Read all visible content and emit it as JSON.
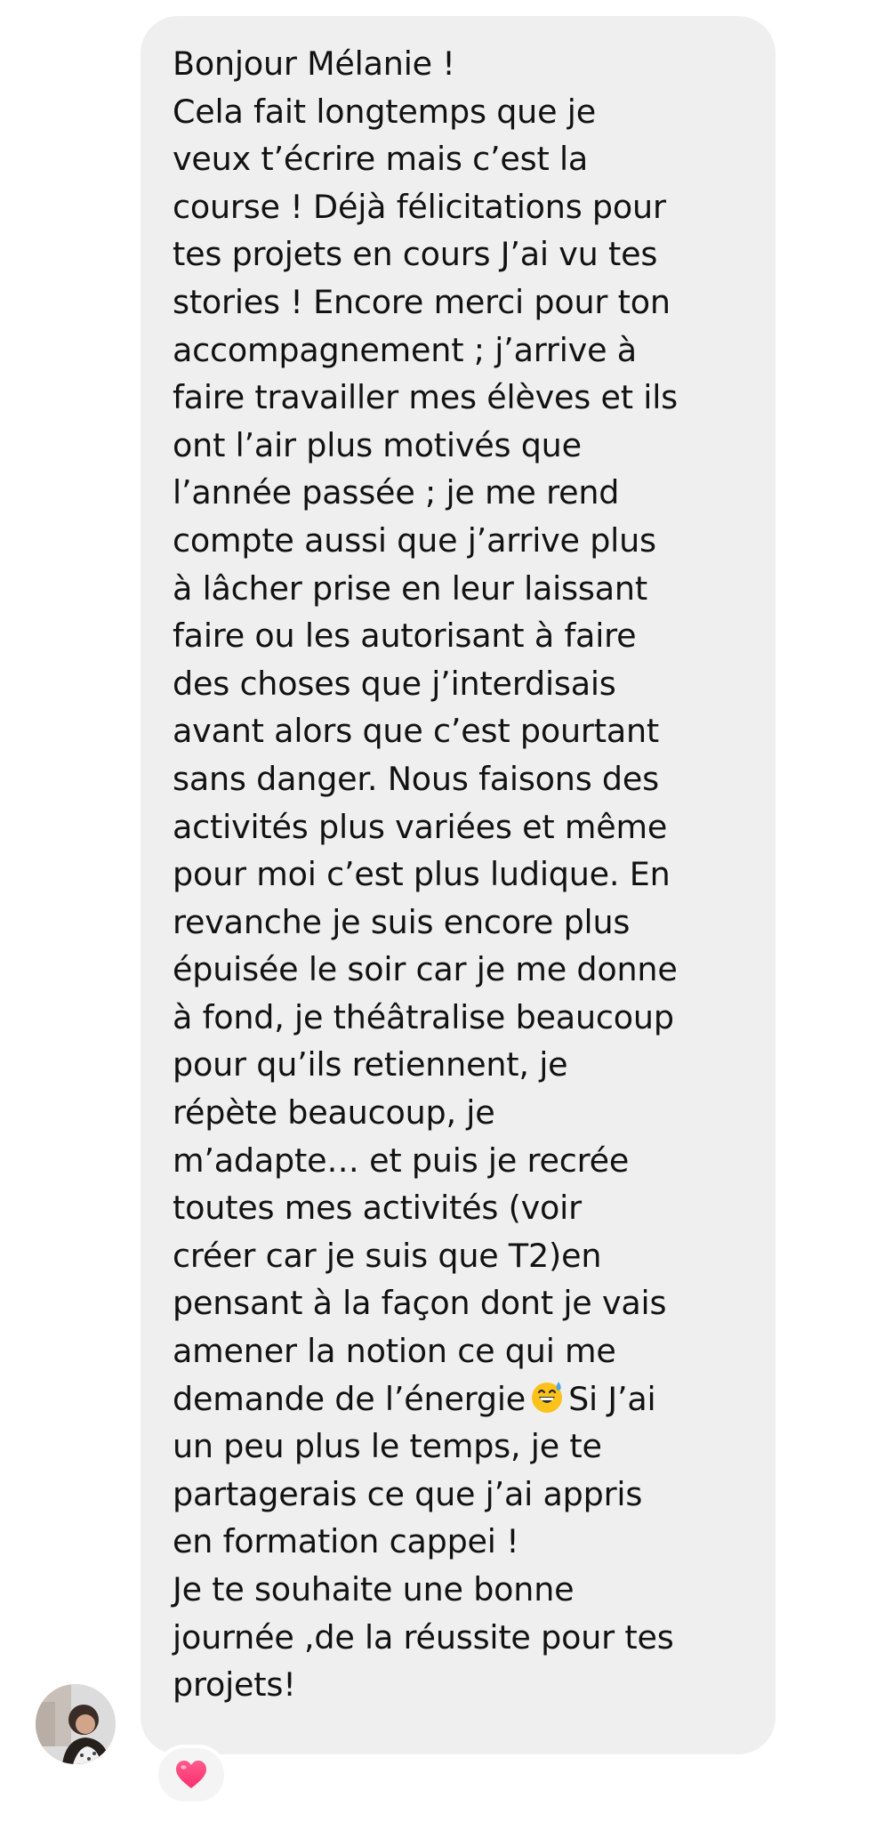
{
  "message": {
    "lines": [
      "Bonjour Mélanie !",
      "Cela fait longtemps que je",
      "veux t’écrire mais c’est la",
      "course ! Déjà félicitations pour",
      "tes projets en cours J’ai vu tes",
      "stories ! Encore merci pour ton",
      "accompagnement ; j’arrive à",
      "faire travailler mes élèves et ils",
      "ont l’air plus motivés que",
      "l’année passée ; je me rend",
      "compte aussi que j’arrive plus",
      "à lâcher prise en leur laissant",
      "faire ou les autorisant à faire",
      "des choses que j’interdisais",
      "avant alors que c’est pourtant",
      "sans danger. Nous faisons des",
      "activités plus variées et même",
      "pour moi c’est plus ludique. En",
      "revanche je suis encore plus",
      "épuisée le soir car je me donne",
      "à fond, je théâtralise beaucoup",
      "pour qu’ils retiennent, je",
      "répète beaucoup, je",
      "m’adapte… et puis je recrée",
      "toutes mes activités (voir",
      "créer car je suis que T2)en",
      "pensant à la façon dont je vais",
      "amener la notion ce qui me"
    ],
    "emoji_line_before": "demande de l’énergie",
    "emoji_line_after": "Si J’ai",
    "lines_after_emoji": [
      "un peu plus le temps, je te",
      "partagerais ce que j’ai appris",
      "en formation cappei !",
      "Je te souhaite une bonne",
      "journée ,de la réussite pour tes",
      "projets!"
    ],
    "emoji_icon": "grinning-face-with-sweat-icon"
  },
  "reaction": {
    "icon": "heart-icon",
    "color": "#ff2d6f"
  },
  "avatar": {
    "icon": "user-avatar-photo"
  },
  "colors": {
    "bubble": "#efefef",
    "text": "#121212",
    "heart": "#ff2d6f"
  }
}
